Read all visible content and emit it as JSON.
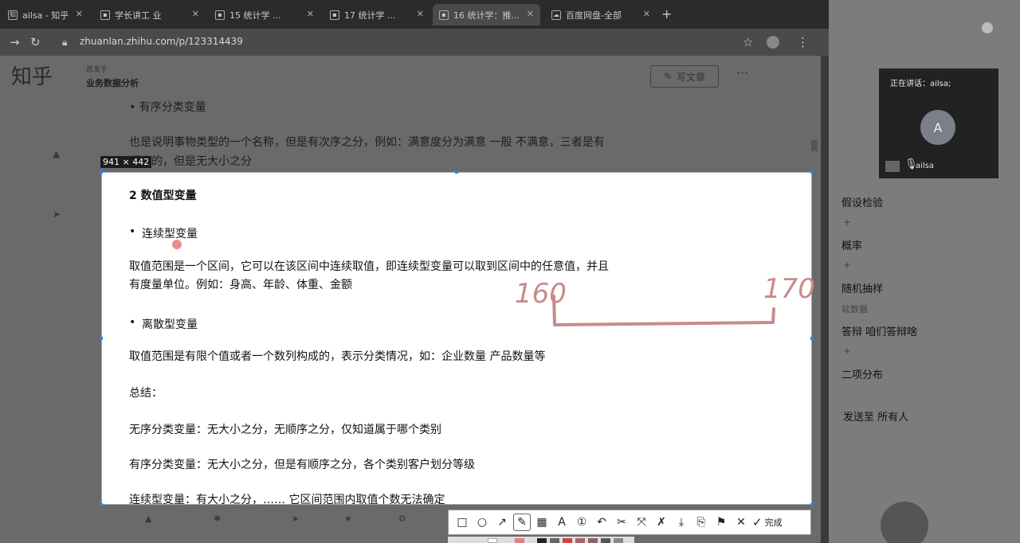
{
  "browser": {
    "tabs": [
      {
        "label": "ailsa - 知乎",
        "icon": "zhihu-icon"
      },
      {
        "label": "学长讲工 业",
        "icon": "doc-icon"
      },
      {
        "label": "15 统计学 ...",
        "icon": "doc-icon"
      },
      {
        "label": "17 统计学 ...",
        "icon": "doc-icon"
      },
      {
        "label": "16 统计学：推...",
        "icon": "doc-icon",
        "active": true
      },
      {
        "label": "百度网盘-全部",
        "icon": "cloud-icon"
      }
    ],
    "url": "zhuanlan.zhihu.com/p/123314439"
  },
  "zhihu": {
    "logo": "知乎",
    "column_small": "首发于",
    "column_title": "业务数据分析",
    "write_button": "写文章",
    "article_lines": [
      "•   有序分类变量",
      "也是说明事物类型的一个名称，但是有次序之分，例如：满意度分为满意 一般 不满意，三者是有",
      "顺序的，但是无大小之分"
    ]
  },
  "capture": {
    "size_label": "941 × 442",
    "heading": "2 数值型变量",
    "bullet_continuous": "连续型变量",
    "para_continuous_1": "取值范围是一个区间，它可以在该区间中连续取值，即连续型变量可以取到区间中的任意值，并且",
    "para_continuous_2": "有度量单位。例如：身高、年龄、体重、金额",
    "bullet_discrete": "离散型变量",
    "para_discrete": "取值范围是有限个值或者一个数列构成的，表示分类情况，如：企业数量 产品数量等",
    "summary": "总结：",
    "summary_1": "无序分类变量：无大小之分，无顺序之分，仅知道属于哪个类别",
    "summary_2": "有序分类变量：无大小之分，但是有顺序之分，各个类别客户划分等级",
    "summary_3_partial": "连续型变量：有大小之分，…… 它区间范围内取值个数无法确定"
  },
  "annotation": {
    "left_number": "160",
    "right_number": "170",
    "color": "#c98a8a"
  },
  "meeting": {
    "speaking_label": "正在讲话：ailsa;",
    "avatar_letter": "A",
    "participant_name": "ailsa",
    "topics": [
      "假设检验",
      "概率",
      "随机抽样",
      "答辩 咱们答辩啥",
      "二项分布"
    ],
    "faint_label": "软数据",
    "send_to": "发送至 所有人"
  },
  "toolbar": {
    "tools": [
      {
        "name": "rectangle-tool-icon",
        "glyph": "□"
      },
      {
        "name": "ellipse-tool-icon",
        "glyph": "○"
      },
      {
        "name": "arrow-tool-icon",
        "glyph": "↗"
      },
      {
        "name": "pen-tool-icon",
        "glyph": "✎",
        "selected": true
      },
      {
        "name": "mosaic-tool-icon",
        "glyph": "▦"
      },
      {
        "name": "text-tool-icon",
        "glyph": "A"
      },
      {
        "name": "number-tool-icon",
        "glyph": "①"
      },
      {
        "name": "undo-icon",
        "glyph": "↶"
      },
      {
        "name": "scissors-icon",
        "glyph": "✂"
      },
      {
        "name": "expand-icon",
        "glyph": "⤧"
      },
      {
        "name": "pin-icon",
        "glyph": "✗"
      },
      {
        "name": "download-icon",
        "glyph": "⤓"
      },
      {
        "name": "copy-icon",
        "glyph": "⎘"
      },
      {
        "name": "bookmark-icon",
        "glyph": "⚑"
      },
      {
        "name": "close-icon",
        "glyph": "✕"
      }
    ],
    "done_label": "完成"
  }
}
